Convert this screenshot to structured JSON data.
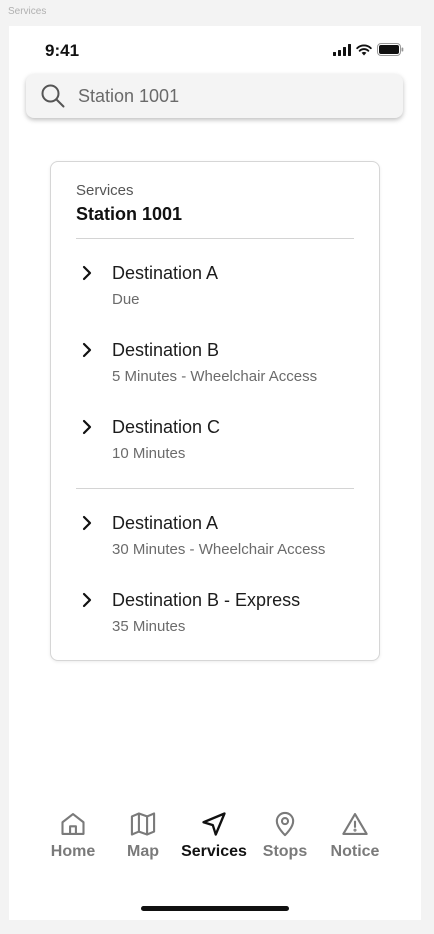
{
  "frame_label": "Services",
  "status_bar": {
    "time": "9:41"
  },
  "search": {
    "value": "Station 1001"
  },
  "card": {
    "kicker": "Services",
    "title": "Station 1001",
    "groups": [
      [
        {
          "destination": "Destination A",
          "info": "Due"
        },
        {
          "destination": "Destination B",
          "info": "5 Minutes - Wheelchair Access"
        },
        {
          "destination": "Destination C",
          "info": "10 Minutes"
        }
      ],
      [
        {
          "destination": "Destination A",
          "info": "30 Minutes - Wheelchair Access"
        },
        {
          "destination": "Destination B - Express",
          "info": "35 Minutes"
        }
      ]
    ]
  },
  "tabs": [
    {
      "label": "Home",
      "icon": "home-icon"
    },
    {
      "label": "Map",
      "icon": "map-icon"
    },
    {
      "label": "Services",
      "icon": "navigation-icon",
      "active": true
    },
    {
      "label": "Stops",
      "icon": "map-pin-icon"
    },
    {
      "label": "Notice",
      "icon": "alert-triangle-icon"
    }
  ]
}
